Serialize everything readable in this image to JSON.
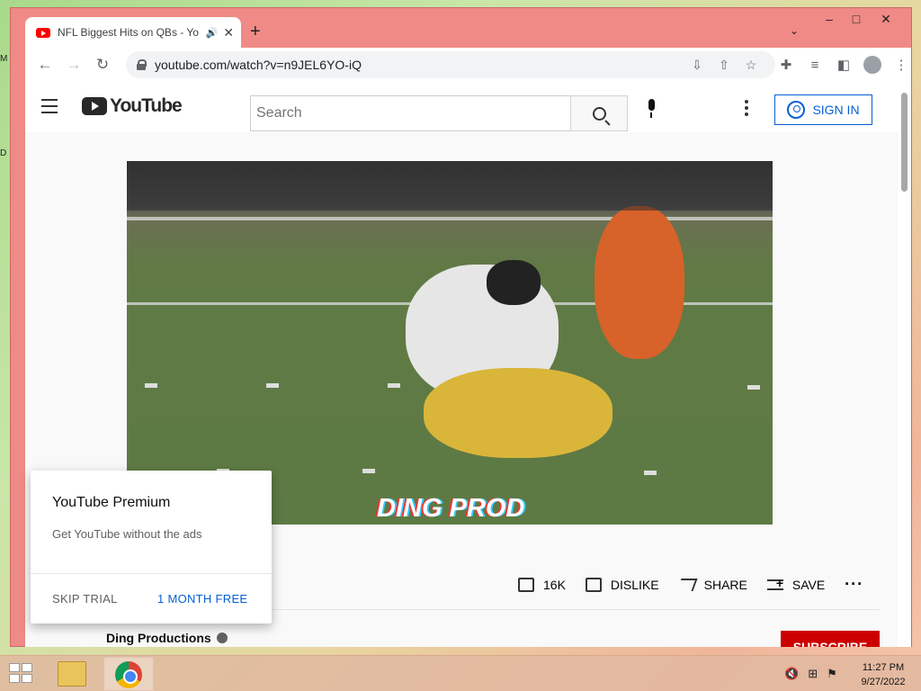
{
  "browser": {
    "tab_title": "NFL Biggest Hits on QBs - Yo",
    "new_tab": "+",
    "url": "youtube.com/watch?v=n9JEL6YO-iQ"
  },
  "youtube": {
    "logo_text": "YouTube",
    "search_placeholder": "Search",
    "sign_in": "SIGN IN",
    "video_watermark": "DING PROD",
    "actions": {
      "like_count": "16K",
      "dislike": "DISLIKE",
      "share": "SHARE",
      "save": "SAVE"
    },
    "channel_name": "Ding Productions",
    "subscribe": "SUBSCRIBE"
  },
  "premium_popup": {
    "title": "YouTube Premium",
    "description": "Get YouTube without the ads",
    "skip": "SKIP TRIAL",
    "free": "1 MONTH FREE"
  },
  "taskbar": {
    "time": "11:27 PM",
    "date": "9/27/2022"
  },
  "colors": {
    "titlebar": "#ef8a86",
    "youtube_red": "#ff0000",
    "link_blue": "#065fd4",
    "subscribe_red": "#cc0000"
  }
}
